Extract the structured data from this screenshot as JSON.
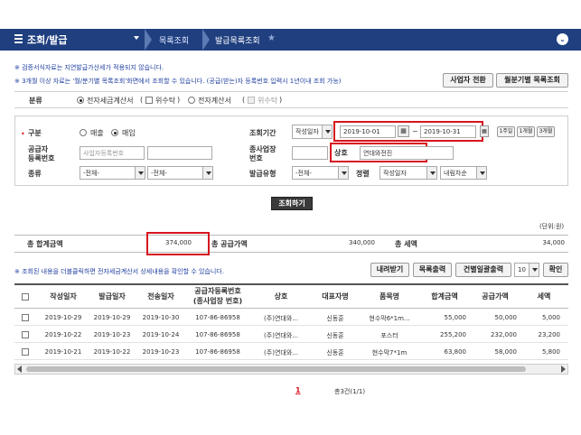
{
  "nav": {
    "title": "조회/발급",
    "crumb1": "목록조회",
    "crumb2": "발급목록조회"
  },
  "notices": {
    "n1": "※ 검증서식자료는 지연발급가산세가 적용되지 않습니다.",
    "n2": "※ 3개월 이상 자료는 '월/분기별 목록조회'화면에서 조회할 수 있습니다. (공급(받는)자 등록번호 입력시 1년이내 조회 가능)"
  },
  "top_buttons": {
    "switch_user": "사업자 전환",
    "monthly_list": "월분기별 목록조회"
  },
  "category": {
    "label": "분류",
    "opt_etax": "전자세금계산서",
    "opt_etax_mod": "위수탁",
    "opt_einvoice": "전자계산서",
    "opt_einvoice_mod": "위수탁"
  },
  "filters": {
    "type_label": "구분",
    "type_sell": "매출",
    "type_buy": "매입",
    "period_label": "조회기간",
    "period_basis": "작성일자",
    "date_from": "2019-10-01",
    "date_to": "2019-10-31",
    "date_sep": "~",
    "quick_1w": "1주일",
    "quick_1m": "1개월",
    "quick_3m": "3개월",
    "supplier_label_1": "공급자",
    "supplier_label_2": "등록번호",
    "supplier_placeholder": "사업자등록번호",
    "subbiz_label_1": "종사업장",
    "subbiz_label_2": "번호",
    "company_label": "상호",
    "company_value": "연대와전진",
    "kind_label": "종류",
    "kind_1": "-전체-",
    "kind_2": "-전체-",
    "issue_type_label": "발급유형",
    "issue_type": "-전체-",
    "sort_label": "정렬",
    "sort_by": "작성일자",
    "sort_order": "내림차순",
    "search_button": "조회하기"
  },
  "summary": {
    "unit": "(단위:원)",
    "total_label": "총 합계금액",
    "total_value": "374,000",
    "supply_label": "총 공급가액",
    "supply_value": "340,000",
    "tax_label": "총 세액",
    "tax_value": "34,000"
  },
  "list_toolbar": {
    "hint": "※ 조회된 내용을 더블클릭하면 전자세금계산서 상세내용을 확인할 수 있습니다.",
    "download": "내려받기",
    "print_list": "목록출력",
    "batch_print": "건별일괄출력",
    "page_size": "10",
    "confirm": "확인"
  },
  "table": {
    "headers": [
      "작성일자",
      "발급일자",
      "전송일자",
      "공급자등록번호",
      "(종사업장 번호)",
      "상호",
      "대표자명",
      "품목명",
      "합계금액",
      "공급가액",
      "세액"
    ],
    "rows": [
      [
        "2019-10-29",
        "2019-10-29",
        "2019-10-30",
        "107-86-86958",
        "(주)연대와...",
        "신동훈",
        "현수막6*1m...",
        "55,000",
        "50,000",
        "5,000"
      ],
      [
        "2019-10-22",
        "2019-10-23",
        "2019-10-24",
        "107-86-86958",
        "(주)연대와...",
        "신동훈",
        "포스터",
        "255,200",
        "232,000",
        "23,200"
      ],
      [
        "2019-10-21",
        "2019-10-22",
        "2019-10-23",
        "107-86-86958",
        "(주)연대와...",
        "신동훈",
        "현수막7*1m",
        "63,800",
        "58,000",
        "5,800"
      ]
    ]
  },
  "pagination": {
    "current": "1",
    "total": "총3건(1/1)"
  }
}
